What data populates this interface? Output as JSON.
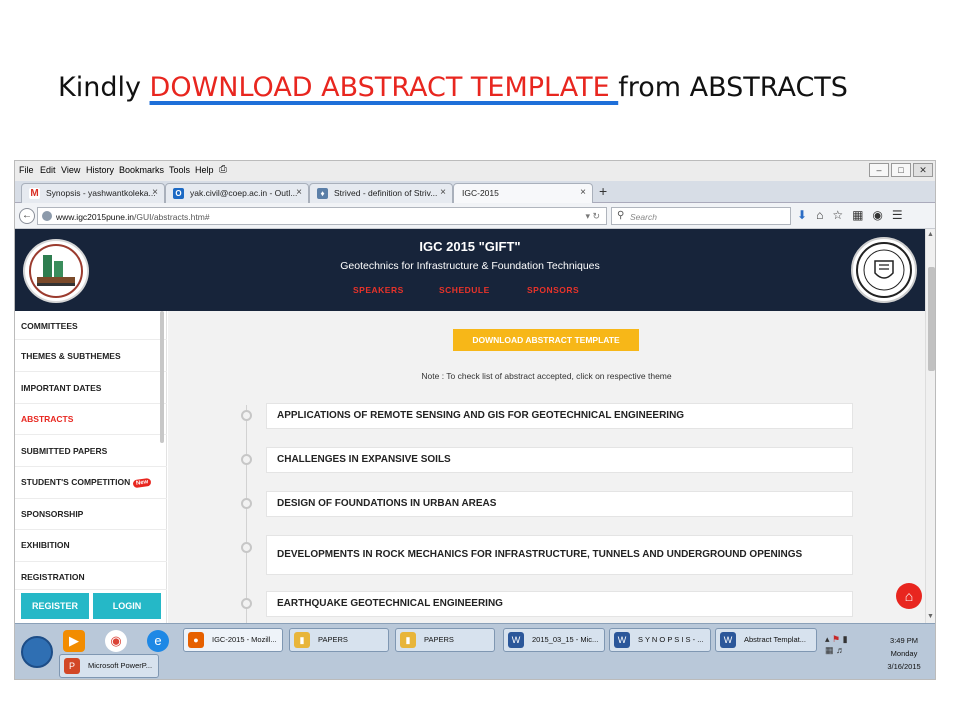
{
  "caption": {
    "prefix": "Kindly ",
    "highlight": "DOWNLOAD ABSTRACT TEMPLATE ",
    "suffix": "from ABSTRACTS"
  },
  "colors": {
    "caption_highlight": "#e8261f",
    "caption_underline": "#1e6fd9",
    "header_bg": "#17243a",
    "accent_red": "#e8261f",
    "download_button": "#f7b718",
    "sidebar_buttons": "#25b8c7"
  },
  "browser": {
    "menu": [
      "File",
      "Edit",
      "View",
      "History",
      "Bookmarks",
      "Tools",
      "Help"
    ],
    "tabs": [
      {
        "label": "Synopsis - yashwantkoleka...",
        "icon": "gmail-icon",
        "active": false
      },
      {
        "label": "yak.civil@coep.ac.in - Outl...",
        "icon": "outlook-icon",
        "active": false
      },
      {
        "label": "Strived - definition of Striv...",
        "icon": "dictionary-icon",
        "active": false
      },
      {
        "label": "IGC-2015",
        "icon": "",
        "active": true
      }
    ],
    "url_host": "www.igc2015pune.in",
    "url_path": "/GUI/abstracts.htm#",
    "search_placeholder": "Search"
  },
  "site": {
    "title": "IGC 2015 \"GIFT\"",
    "subtitle": "Geotechnics for Infrastructure & Foundation Techniques",
    "nav": [
      "SPEAKERS",
      "SCHEDULE",
      "SPONSORS"
    ]
  },
  "sidebar": {
    "items": [
      {
        "label": "COMMITTEES",
        "active": false
      },
      {
        "label": "THEMES & SUBTHEMES",
        "active": false
      },
      {
        "label": "IMPORTANT DATES",
        "active": false
      },
      {
        "label": "ABSTRACTS",
        "active": true
      },
      {
        "label": "SUBMITTED PAPERS",
        "active": false
      },
      {
        "label": "STUDENT'S COMPETITION",
        "active": false,
        "badge": "New"
      },
      {
        "label": "SPONSORSHIP",
        "active": false
      },
      {
        "label": "EXHIBITION",
        "active": false
      },
      {
        "label": "REGISTRATION",
        "active": false
      }
    ],
    "register_label": "REGISTER",
    "login_label": "LOGIN"
  },
  "main": {
    "download_label": "DOWNLOAD ABSTRACT TEMPLATE",
    "note": "Note : To check list of abstract accepted, click on respective theme",
    "themes": [
      "APPLICATIONS OF REMOTE SENSING AND GIS FOR GEOTECHNICAL ENGINEERING",
      "CHALLENGES IN EXPANSIVE SOILS",
      "DESIGN OF FOUNDATIONS IN URBAN AREAS",
      "DEVELOPMENTS IN ROCK MECHANICS FOR INFRASTRUCTURE, TUNNELS AND UNDERGROUND OPENINGS",
      "EARTHQUAKE GEOTECHNICAL ENGINEERING"
    ]
  },
  "taskbar": {
    "buttons": [
      {
        "label": "IGC-2015 - Mozill...",
        "icon": "firefox-icon",
        "active": true
      },
      {
        "label": "PAPERS",
        "icon": "folder-icon",
        "active": false
      },
      {
        "label": "PAPERS",
        "icon": "folder-icon",
        "active": false
      },
      {
        "label": "2015_03_15 - Mic...",
        "icon": "word-icon",
        "active": false
      },
      {
        "label": "S Y N O P S I S - ...",
        "icon": "word-icon",
        "active": false
      },
      {
        "label": "Abstract Templat...",
        "icon": "word-icon",
        "active": false
      },
      {
        "label": "Microsoft PowerP...",
        "icon": "powerpoint-icon",
        "active": false
      }
    ],
    "time": "3:49 PM",
    "day": "Monday",
    "date": "3/16/2015"
  }
}
